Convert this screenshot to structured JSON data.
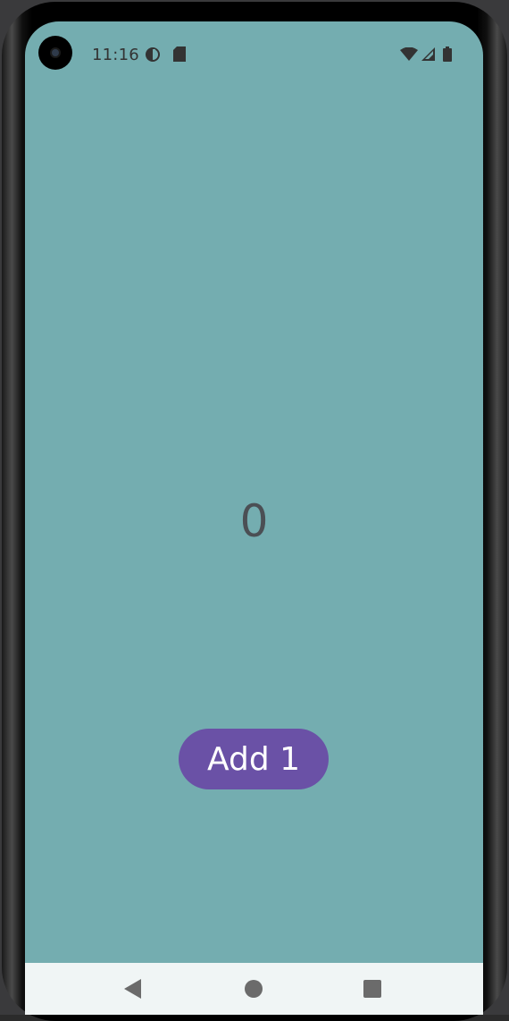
{
  "status_bar": {
    "time": "11:16",
    "icons": [
      "privacy-indicator-icon",
      "sd-card-icon",
      "wifi-icon",
      "cell-signal-icon",
      "battery-icon"
    ]
  },
  "main": {
    "counter_value": "0",
    "add_button_label": "Add 1"
  },
  "nav_bar": {
    "buttons": [
      "back-icon",
      "home-icon",
      "recents-icon"
    ]
  },
  "colors": {
    "background": "#74adb0",
    "button": "#6a51a6",
    "button_text": "#ffffff",
    "counter_text": "#4b4f54",
    "nav_bar": "#f0f5f5"
  }
}
